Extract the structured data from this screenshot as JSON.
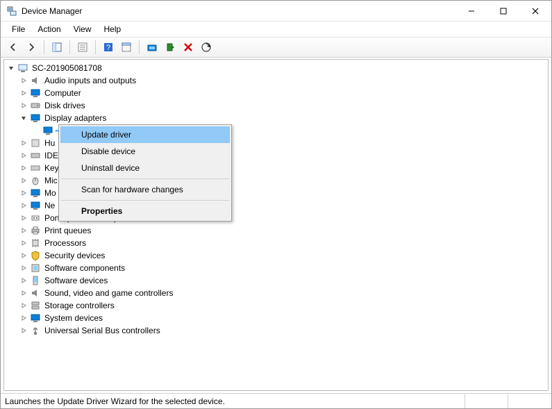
{
  "title": "Device Manager",
  "menu": {
    "file": "File",
    "action": "Action",
    "view": "View",
    "help": "Help"
  },
  "tree": {
    "root": "SC-201905081708",
    "items": [
      "Audio inputs and outputs",
      "Computer",
      "Disk drives",
      "Display adapters",
      "Hu",
      "IDE",
      "Key",
      "Mic",
      "Mo",
      "Ne",
      "Ports (COM & LPT)",
      "Print queues",
      "Processors",
      "Security devices",
      "Software components",
      "Software devices",
      "Sound, video and game controllers",
      "Storage controllers",
      "System devices",
      "Universal Serial Bus controllers"
    ],
    "selected_child_placeholder": ""
  },
  "context_menu": {
    "update_driver": "Update driver",
    "disable_device": "Disable device",
    "uninstall_device": "Uninstall device",
    "scan": "Scan for hardware changes",
    "properties": "Properties"
  },
  "status": "Launches the Update Driver Wizard for the selected device."
}
